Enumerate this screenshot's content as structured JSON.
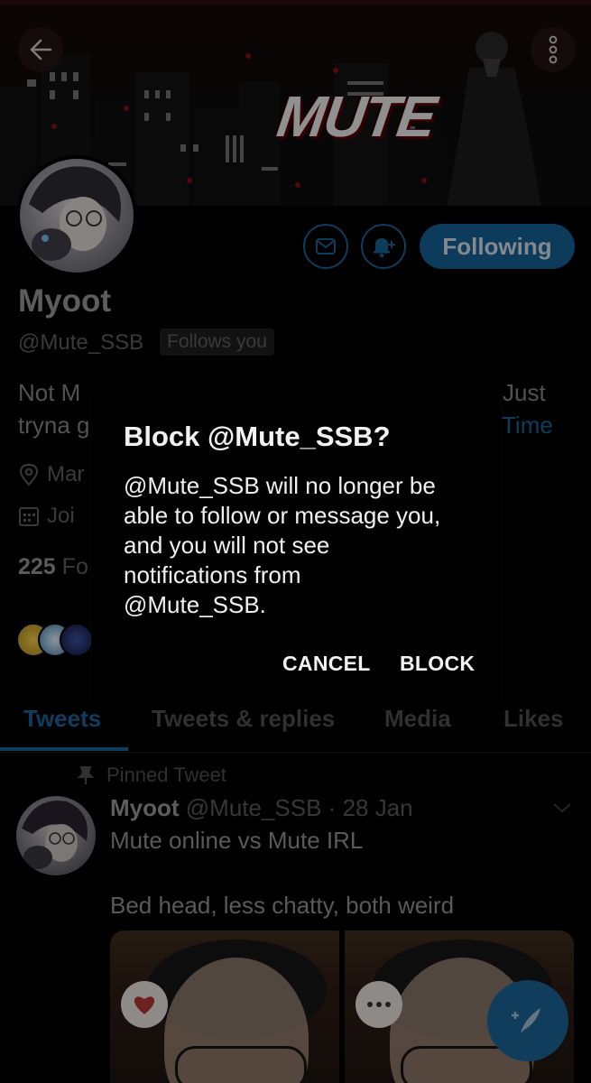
{
  "banner": {
    "title": "MUTE"
  },
  "profile": {
    "name": "Myoot",
    "handle": "@Mute_SSB",
    "follows_you": "Follows you",
    "bio_line1_visible": "Not M",
    "bio_line1_right": "Just",
    "bio_line2_visible": "tryna g",
    "bio_line2_right": "Time",
    "location_visible": "Mar",
    "joined_visible": "Joi",
    "followers_count": "225",
    "followers_label_visible": "Fo",
    "following_button": "Following"
  },
  "tabs": [
    {
      "label": "Tweets",
      "active": true
    },
    {
      "label": "Tweets & replies",
      "active": false
    },
    {
      "label": "Media",
      "active": false
    },
    {
      "label": "Likes",
      "active": false
    }
  ],
  "tweet": {
    "pinned_label": "Pinned Tweet",
    "author_name": "Myoot",
    "author_handle_date": "@Mute_SSB · 28 Jan",
    "line1": "Mute online vs Mute IRL",
    "line2": "Bed head, less chatty, both weird"
  },
  "dialog": {
    "title": "Block @Mute_SSB?",
    "body": "@Mute_SSB will no longer be able to follow or message you, and you will not see notifications from @Mute_SSB.",
    "cancel": "CANCEL",
    "confirm": "BLOCK"
  },
  "colors": {
    "accent": "#1da1f2",
    "accent_dimmed": "#155f8f",
    "background": "#000000"
  },
  "icons": [
    "back-arrow-icon",
    "more-vertical-icon",
    "mail-icon",
    "bell-plus-icon",
    "location-pin-icon",
    "calendar-icon",
    "pin-icon",
    "chevron-down-icon",
    "compose-feather-icon",
    "heart-icon",
    "speech-bubble-icon"
  ]
}
